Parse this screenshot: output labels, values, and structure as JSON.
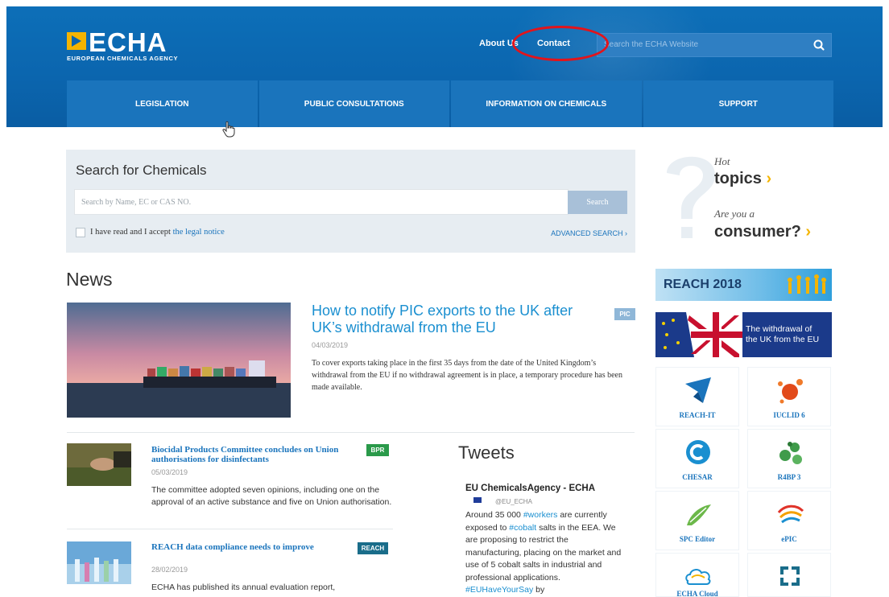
{
  "header": {
    "logo_name": "ECHA",
    "logo_sub": "EUROPEAN CHEMICALS AGENCY",
    "about_label": "About Us",
    "contact_label": "Contact",
    "search_placeholder": "Search the ECHA Website"
  },
  "nav": [
    {
      "label": "LEGISLATION"
    },
    {
      "label": "PUBLIC CONSULTATIONS"
    },
    {
      "label": "INFORMATION ON CHEMICALS"
    },
    {
      "label": "SUPPORT"
    }
  ],
  "chem_search": {
    "title": "Search for Chemicals",
    "placeholder": "Search by Name, EC or CAS NO.",
    "button": "Search",
    "legal_prefix": "I have read and I accept",
    "legal_link": "the legal notice",
    "advanced": "ADVANCED SEARCH ›"
  },
  "news": {
    "heading": "News",
    "main": {
      "title": "How to notify PIC exports to the UK after UK’s withdrawal from the EU",
      "tag": "PIC",
      "date": "04/03/2019",
      "text": "To cover exports taking place in the first 35 days from the date of the United Kingdom’s withdrawal from the EU if no withdrawal agreement is in place, a temporary procedure has been made available."
    },
    "items": [
      {
        "title": "Biocidal Products Committee concludes on Union authorisations for disinfectants",
        "tag": "BPR",
        "date": "05/03/2019",
        "text": "The committee adopted seven opinions, including one on the approval of an active substance and five on Union authorisation."
      },
      {
        "title": "REACH data compliance needs to improve",
        "tag": "REACH",
        "date": "28/02/2019",
        "text": "ECHA has published its annual evaluation report,"
      }
    ]
  },
  "tweets": {
    "heading": "Tweets",
    "name": "EU ChemicalsAgency - ECHA",
    "handle": "@EU_ECHA",
    "text_parts": {
      "p1": "Around 35 000 ",
      "h1": "#workers",
      "p2": " are currently exposed to ",
      "h2": "#cobalt",
      "p3": " salts in the EEA. We are proposing to restrict the manufacturing, placing on the market and use of 5 cobalt salts in industrial and professional applications. ",
      "h3": "#EUHaveYourSay",
      "p4": " by"
    }
  },
  "sidebar": {
    "hot_line1": "Hot",
    "hot_line2": "topics",
    "consumer_line1": "Are you a",
    "consumer_line2": "consumer?",
    "reach_banner": "REACH 2018",
    "brexit_line1": "The withdrawal of",
    "brexit_line2": "the UK from the EU",
    "tiles": [
      {
        "label": "REACH-IT"
      },
      {
        "label": "IUCLID 6"
      },
      {
        "label": "CHESAR"
      },
      {
        "label": "R4BP 3"
      },
      {
        "label": "SPC Editor"
      },
      {
        "label": "ePIC"
      },
      {
        "label": "ECHA Cloud"
      },
      {
        "label": ""
      }
    ]
  },
  "colors": {
    "header_blue": "#0b65ae",
    "link_blue": "#1a74bc",
    "accent_yellow": "#f4b400",
    "annotation_red": "#e2141b",
    "tag_pic": "#8fb7d8",
    "tag_bpr": "#2a9a4a",
    "tag_reach": "#1a6d8a"
  }
}
